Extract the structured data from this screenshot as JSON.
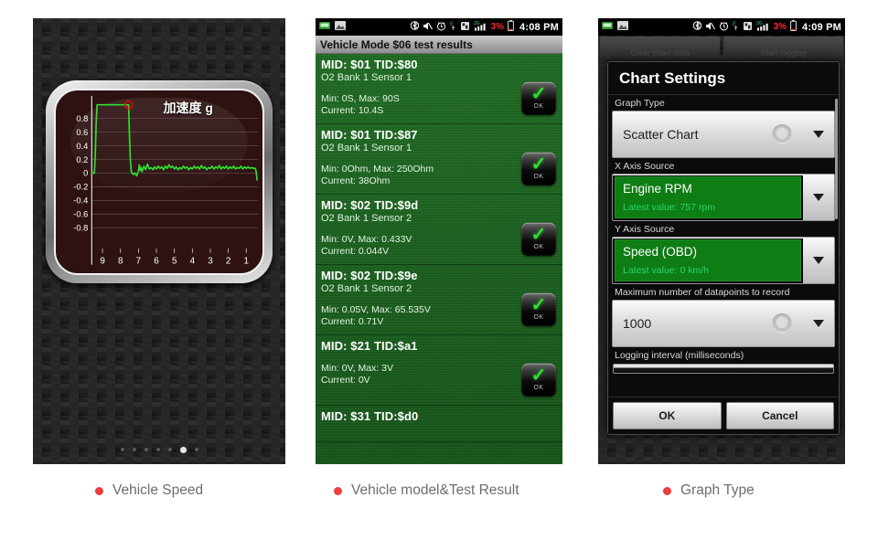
{
  "panel1": {
    "name": "vehicle-speed-widget",
    "chart_label": "加速度 g",
    "page_dots": 7,
    "active_dot": 6,
    "chart_data": {
      "type": "line",
      "title": "加速度 g",
      "xlabel": "",
      "ylabel": "",
      "ylim": [
        -1.0,
        1.0
      ],
      "yticks": [
        0.8,
        0.6,
        0.4,
        0.2,
        0,
        -0.2,
        -0.4,
        -0.6,
        -0.8
      ],
      "xticks": [
        9,
        8,
        7,
        6,
        5,
        4,
        3,
        2,
        1
      ],
      "xlim": [
        9.6,
        0.3
      ],
      "grid": true,
      "line_color": "#2fe02f",
      "marker": {
        "x": 7.55,
        "y": 1.0,
        "color": "#ff0000",
        "shape": "circle"
      },
      "x": [
        9.6,
        9.45,
        9.4,
        9.35,
        9.3,
        8.0,
        7.7,
        7.6,
        7.55,
        7.5,
        7.45,
        7.4,
        7.3,
        7.2,
        7.1,
        7.0,
        6.95,
        6.9,
        6.85,
        6.8,
        6.7,
        6.6,
        6.5,
        6.4,
        6.3,
        6.2,
        6.1,
        6.0,
        5.9,
        5.8,
        5.7,
        5.6,
        5.5,
        5.4,
        5.3,
        5.2,
        5.1,
        5.0,
        4.9,
        4.8,
        4.7,
        4.6,
        4.5,
        4.4,
        4.3,
        4.2,
        4.1,
        4.0,
        3.9,
        3.8,
        3.7,
        3.6,
        3.5,
        3.4,
        3.3,
        3.2,
        3.1,
        3.0,
        2.9,
        2.8,
        2.7,
        2.6,
        2.5,
        2.4,
        2.3,
        2.2,
        2.1,
        2.0,
        1.9,
        1.8,
        1.7,
        1.6,
        1.5,
        1.4,
        1.3,
        1.2,
        1.1,
        1.0,
        0.9,
        0.8,
        0.7,
        0.6,
        0.5,
        0.45,
        0.4
      ],
      "y": [
        0,
        0,
        0.3,
        0.75,
        1.0,
        1.0,
        1.0,
        1.0,
        1.0,
        0.55,
        0.2,
        0.02,
        -0.02,
        0.0,
        -0.04,
        0.03,
        0.12,
        0.04,
        0.08,
        0.02,
        0.1,
        0.05,
        0.13,
        0.06,
        0.08,
        0.05,
        0.09,
        0.06,
        0.1,
        0.07,
        0.09,
        0.05,
        0.1,
        0.07,
        0.12,
        0.08,
        0.1,
        0.06,
        0.09,
        0.05,
        0.08,
        0.06,
        0.1,
        0.07,
        0.09,
        0.05,
        0.08,
        0.06,
        0.1,
        0.07,
        0.09,
        0.06,
        0.11,
        0.07,
        0.09,
        0.05,
        0.08,
        0.07,
        0.1,
        0.06,
        0.09,
        0.07,
        0.11,
        0.06,
        0.09,
        0.07,
        0.1,
        0.06,
        0.09,
        0.07,
        0.1,
        0.06,
        0.08,
        0.07,
        0.1,
        0.06,
        0.09,
        0.07,
        0.09,
        0.07,
        0.08,
        0.07,
        0.07,
        0.02,
        -0.1
      ]
    }
  },
  "panel2": {
    "name": "vehicle-mode-06-results",
    "statusbar": {
      "time": "4:08 PM",
      "battery_pct": "3%",
      "signal": "2G",
      "data_type": "E",
      "icons": [
        "obd-app-icon",
        "gallery-icon",
        "bluetooth-icon",
        "mute-icon",
        "alarm-icon",
        "edge-data-icon",
        "sdcard-icon",
        "signal-bars-icon",
        "battery-icon"
      ]
    },
    "title": "Vehicle Mode $06 test results",
    "groups": [
      {
        "mid": "MID: $01 TID:$80",
        "desc": "O2 Bank 1 Sensor 1",
        "minmax": "Min: 0S, Max: 90S",
        "current": "Current: 10.4S",
        "status": "OK"
      },
      {
        "mid": "MID: $01 TID:$87",
        "desc": "O2 Bank 1 Sensor 1",
        "minmax": "Min: 0Ohm, Max: 250Ohm",
        "current": "Current: 38Ohm",
        "status": "OK"
      },
      {
        "mid": "MID: $02 TID:$9d",
        "desc": "O2 Bank 1 Sensor 2",
        "minmax": "Min: 0V, Max: 0.433V",
        "current": "Current: 0.044V",
        "status": "OK"
      },
      {
        "mid": "MID: $02 TID:$9e",
        "desc": "O2 Bank 1 Sensor 2",
        "minmax": "Min: 0.05V, Max: 65.535V",
        "current": "Current: 0.71V",
        "status": "OK"
      },
      {
        "mid": "MID: $21 TID:$a1",
        "desc": "",
        "minmax": "Min: 0V, Max: 3V",
        "current": "Current: 0V",
        "status": "OK"
      },
      {
        "mid": "MID: $31 TID:$d0",
        "desc": "",
        "minmax": "",
        "current": "",
        "status": ""
      }
    ]
  },
  "panel3": {
    "name": "chart-settings-dialog",
    "statusbar": {
      "time": "4:09 PM",
      "battery_pct": "3%",
      "signal": "2G",
      "data_type": "E"
    },
    "background_buttons": [
      {
        "label": "Clear chart data"
      },
      {
        "label": "Start logging"
      }
    ],
    "dialog_title": "Chart Settings",
    "fields": [
      {
        "label": "Graph Type",
        "value": "Scatter Chart",
        "sub": "",
        "kind": "plain"
      },
      {
        "label": "X Axis Source",
        "value": "Engine RPM",
        "sub": "Latest value: 757 rpm",
        "kind": "green"
      },
      {
        "label": "Y Axis Source",
        "value": "Speed (OBD)",
        "sub": "Latest value: 0 km/h",
        "kind": "green"
      },
      {
        "label": "Maximum number of datapoints to record",
        "value": "1000",
        "sub": "",
        "kind": "plain"
      },
      {
        "label": "Logging interval (milliseconds)",
        "value": "",
        "sub": "",
        "kind": "edit"
      }
    ],
    "buttons": {
      "ok": "OK",
      "cancel": "Cancel"
    }
  },
  "captions": [
    {
      "label": "Vehicle Speed"
    },
    {
      "label": "Vehicle model&Test Result"
    },
    {
      "label": "Graph Type"
    }
  ],
  "colors": {
    "accent_red": "#f03c3c",
    "list_green": "#1b6b21",
    "field_green": "#0d7d14",
    "latest_value_green": "#28d66d",
    "line_green": "#2fe02f",
    "caption_gray": "#6d6d6d"
  }
}
